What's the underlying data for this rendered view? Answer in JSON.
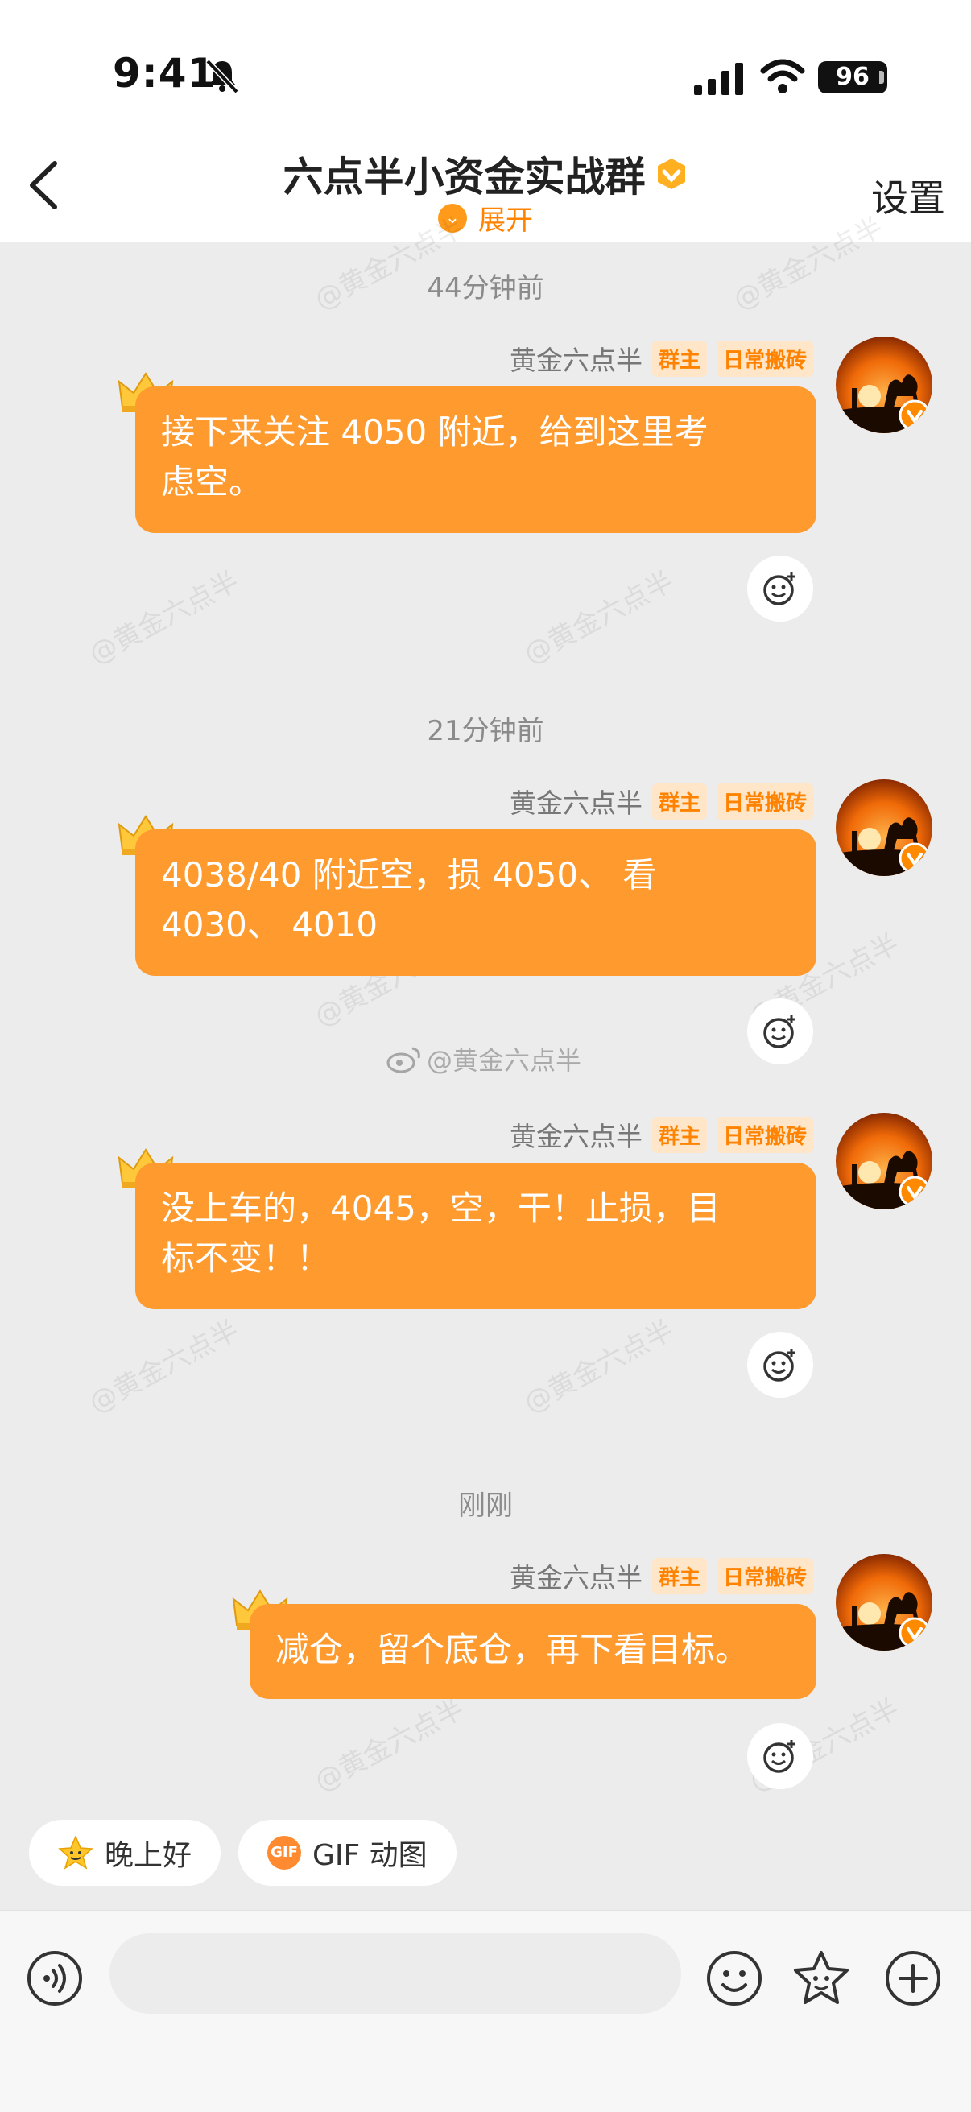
{
  "status": {
    "time": "9:41",
    "battery": "96"
  },
  "header": {
    "title": "六点半小资金实战群",
    "expand_label": "展开",
    "settings_label": "设置"
  },
  "watermark_text": "@黄金六点半",
  "center_watermark": "@黄金六点半",
  "messages": [
    {
      "timestamp": "44分钟前",
      "sender": "黄金六点半",
      "badge_owner": "群主",
      "badge_title": "日常搬砖",
      "lines": [
        "接下来关注 4050 附近，给到这里考",
        "虑空。"
      ]
    },
    {
      "timestamp": "21分钟前",
      "sender": "黄金六点半",
      "badge_owner": "群主",
      "badge_title": "日常搬砖",
      "lines": [
        "4038/40 附近空，损 4050、 看",
        "4030、 4010"
      ]
    },
    {
      "timestamp": "",
      "sender": "黄金六点半",
      "badge_owner": "群主",
      "badge_title": "日常搬砖",
      "lines": [
        "没上车的，4045，空，干！止损，目",
        "标不变！！"
      ]
    },
    {
      "timestamp": "刚刚",
      "sender": "黄金六点半",
      "badge_owner": "群主",
      "badge_title": "日常搬砖",
      "lines": [
        "减仓，留个底仓，再下看目标。"
      ]
    }
  ],
  "quick_replies": [
    {
      "label": "晚上好",
      "icon": "star-emoji-icon"
    },
    {
      "label": "GIF 动图",
      "icon": "gif-icon",
      "icon_text": "GIF"
    }
  ],
  "colors": {
    "accent": "#ff8200",
    "bubble": "#ff9a2e",
    "background": "#ececec"
  }
}
